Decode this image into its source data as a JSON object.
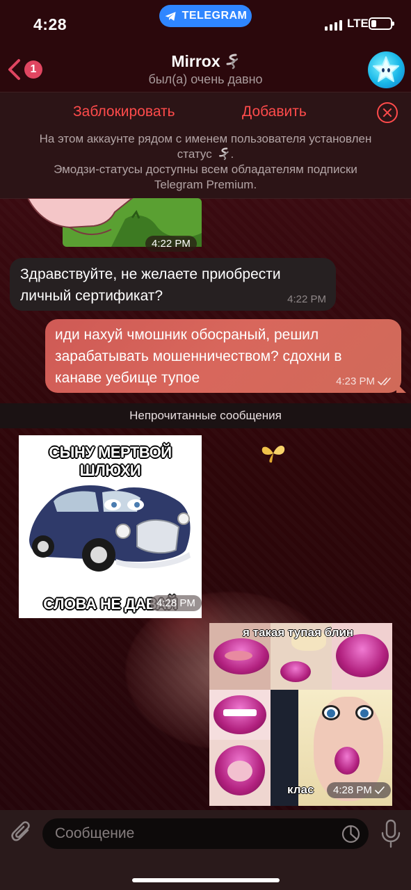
{
  "status_bar": {
    "time": "4:28",
    "app_pill": "TELEGRAM",
    "network": "LTE"
  },
  "header": {
    "back_badge": "1",
    "title": "Mirrox",
    "subtitle": "был(а) очень давно",
    "avatar_icon": "star-avatar-icon"
  },
  "action_panel": {
    "block_label": "Заблокировать",
    "add_label": "Добавить",
    "note_line1": "На этом аккаунте рядом с именем пользователя установлен",
    "note_line2": "статус",
    "note_line3": "Эмодзи-статусы доступны всем обладателям подписки",
    "note_line4": "Telegram Premium."
  },
  "messages": [
    {
      "type": "sticker",
      "time": "4:22 PM"
    },
    {
      "type": "incoming_text",
      "text_line1": "Здравствуйте, не желаете приобрести",
      "text_line2": "личный сертификат?",
      "time": "4:22 PM"
    },
    {
      "type": "outgoing_text",
      "text_line1": "иди нахуй чмошник обосраный, решил",
      "text_line2": "зарабатывать мошенничеством? сдохни в",
      "text_line3": "канаве уебище тупое",
      "time": "4:23 PM",
      "status": "read"
    },
    {
      "type": "incoming_image",
      "caption_top": "СЫНУ МЕРТВОЙ ШЛЮХИ",
      "caption_bottom": "СЛОВА НЕ ДАВАЙ",
      "time": "4:28 PM"
    },
    {
      "type": "outgoing_image",
      "caption_top": "я такая тупая блин",
      "caption_bottom": "клас",
      "time": "4:28 PM",
      "status": "sent"
    }
  ],
  "unread_divider": "Непрочитанные сообщения",
  "composer": {
    "placeholder": "Сообщение"
  },
  "colors": {
    "accent_red": "#ff4b4b",
    "outgoing_bubble": "#d8675c",
    "badge": "#e04661",
    "telegram_blue": "#2f86ff"
  }
}
